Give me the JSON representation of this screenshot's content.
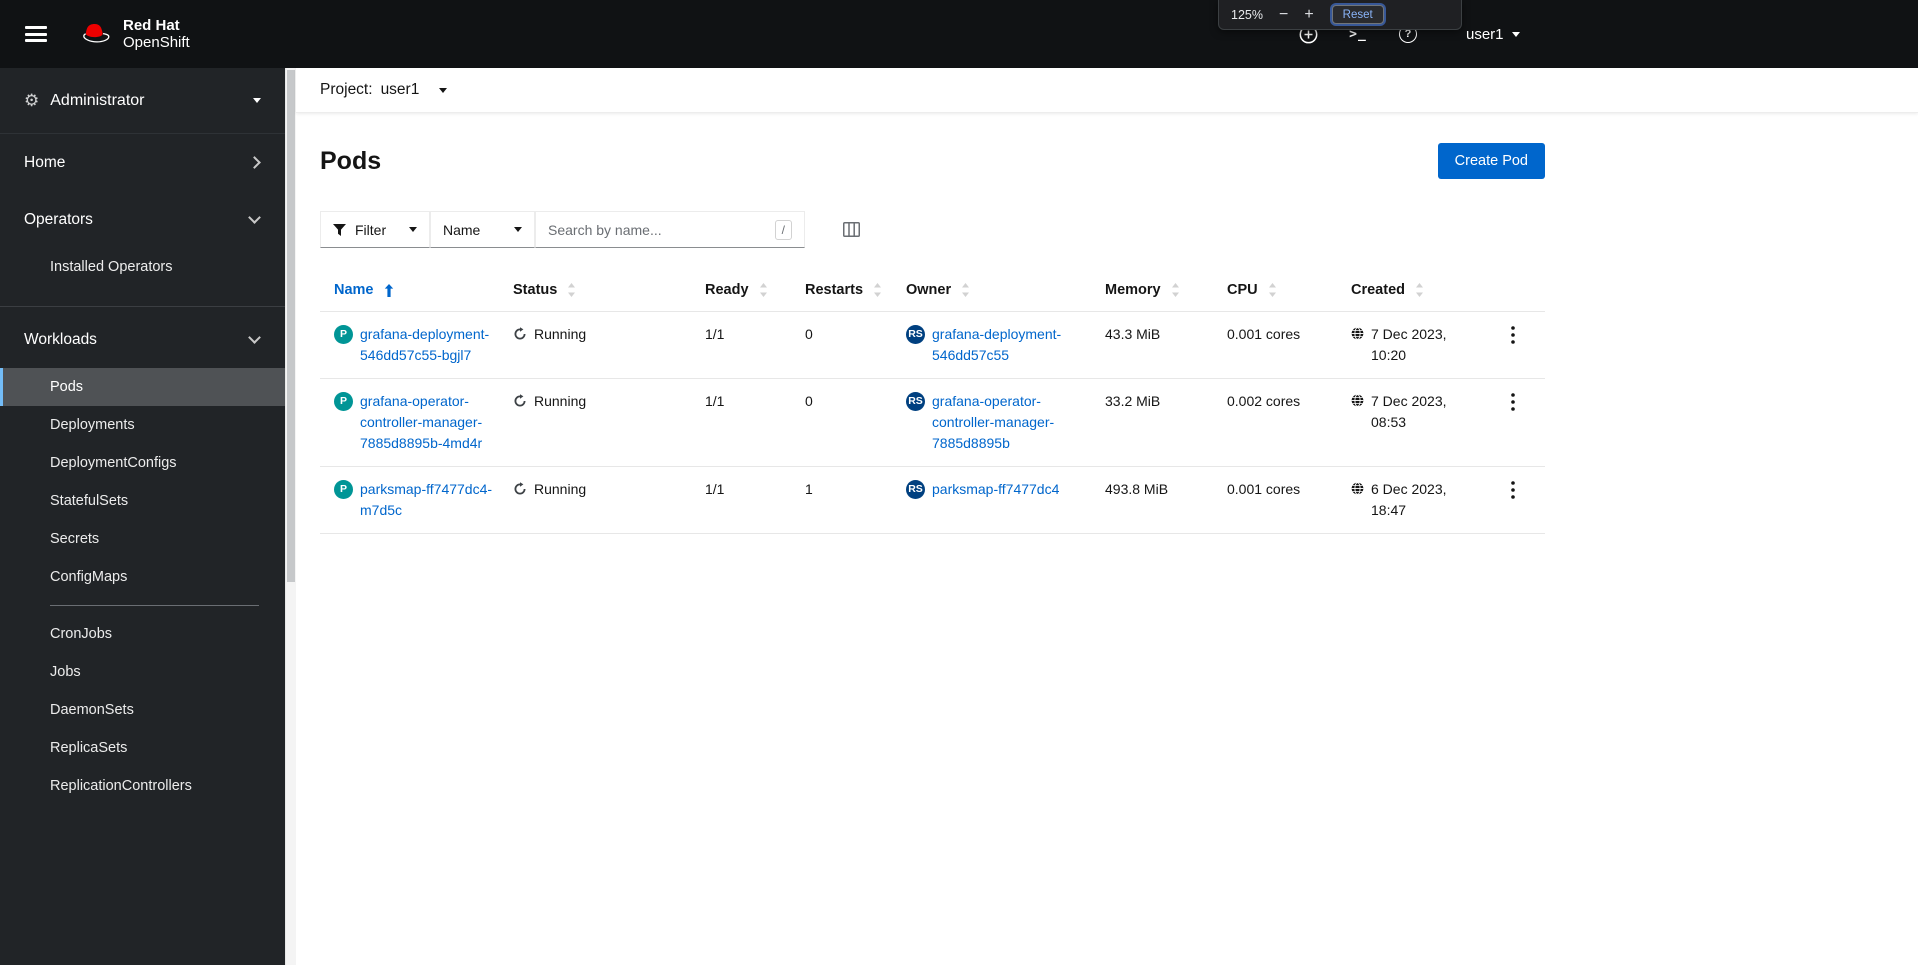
{
  "masthead": {
    "brand_line1": "Red Hat",
    "brand_line2": "OpenShift",
    "user_label": "user1",
    "icons": {
      "quick_create": "plus-circle",
      "web_terminal": "terminal",
      "help": "question-circle",
      "terminal_glyph": ">_",
      "help_glyph": "?",
      "gear_glyph": "⚙"
    }
  },
  "zoom_popup": {
    "level": "125%",
    "minus": "−",
    "plus": "+",
    "reset": "Reset"
  },
  "sidebar": {
    "perspective": "Administrator",
    "home": "Home",
    "operators": "Operators",
    "installed_operators": "Installed Operators",
    "workloads": "Workloads",
    "workloads_items": [
      "Pods",
      "Deployments",
      "DeploymentConfigs",
      "StatefulSets",
      "Secrets",
      "ConfigMaps",
      "CronJobs",
      "Jobs",
      "DaemonSets",
      "ReplicaSets",
      "ReplicationControllers"
    ],
    "active_item": "Pods"
  },
  "project_bar": {
    "label": "Project:",
    "value": "user1"
  },
  "page": {
    "title": "Pods",
    "create_button": "Create Pod"
  },
  "toolbar": {
    "filter": "Filter",
    "name_filter": "Name",
    "search_placeholder": "Search by name...",
    "shortcut_hint": "/"
  },
  "table": {
    "columns": {
      "name": "Name",
      "status": "Status",
      "ready": "Ready",
      "restarts": "Restarts",
      "owner": "Owner",
      "memory": "Memory",
      "cpu": "CPU",
      "created": "Created"
    },
    "sort": {
      "column": "Name",
      "direction": "ascending"
    },
    "badges": {
      "pod": "P",
      "replicaset": "RS"
    },
    "rows": [
      {
        "name": "grafana-deployment-546dd57c55-bgjl7",
        "status": "Running",
        "ready": "1/1",
        "restarts": "0",
        "owner": "grafana-deployment-546dd57c55",
        "memory": "43.3 MiB",
        "cpu": "0.001 cores",
        "created": "7 Dec 2023, 10:20"
      },
      {
        "name": "grafana-operator-controller-manager-7885d8895b-4md4r",
        "status": "Running",
        "ready": "1/1",
        "restarts": "0",
        "owner": "grafana-operator-controller-manager-7885d8895b",
        "memory": "33.2 MiB",
        "cpu": "0.002 cores",
        "created": "7 Dec 2023, 08:53"
      },
      {
        "name": "parksmap-ff7477dc4-m7d5c",
        "status": "Running",
        "ready": "1/1",
        "restarts": "1",
        "owner": "parksmap-ff7477dc4",
        "memory": "493.8 MiB",
        "cpu": "0.001 cores",
        "created": "6 Dec 2023, 18:47"
      }
    ]
  },
  "colors": {
    "link": "#0066cc",
    "primary_button": "#0066cc",
    "pod_badge": "#009596",
    "replicaset_badge": "#004080",
    "nav_active_border": "#73bcf7",
    "masthead_bg": "#101214",
    "sidebar_bg": "#212427"
  }
}
